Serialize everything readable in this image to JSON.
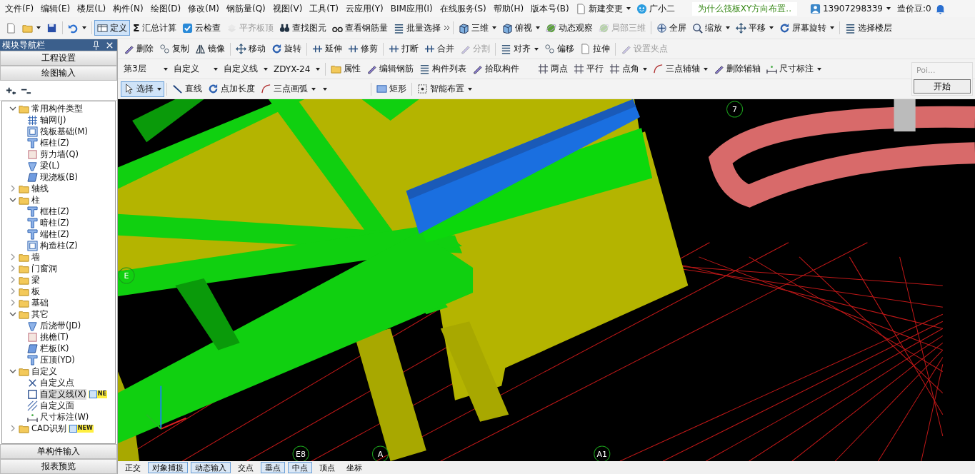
{
  "menu": [
    "文件(F)",
    "编辑(E)",
    "楼层(L)",
    "构件(N)",
    "绘图(D)",
    "修改(M)",
    "钢筋量(Q)",
    "视图(V)",
    "工具(T)",
    "云应用(Y)",
    "BIM应用(I)",
    "在线服务(S)",
    "帮助(H)",
    "版本号(B)"
  ],
  "top_right": {
    "new_change": "新建变更",
    "assistant": "广小二",
    "question": "为什么筏板XY方向布置..",
    "account": "13907298339",
    "beans": "造价豆:0"
  },
  "main_toolbar": [
    [
      {
        "dropdown": false,
        "disabled": false,
        "selected": false
      },
      {
        "dropdown": true,
        "disabled": false,
        "selected": false
      },
      {
        "dropdown": false,
        "disabled": false,
        "selected": false
      }
    ],
    [
      {
        "dropdown": true,
        "disabled": false,
        "selected": false
      }
    ],
    [
      {
        "label": "定义",
        "dropdown": false,
        "disabled": false,
        "selected": true
      },
      {
        "label": "汇总计算",
        "glyph": "Σ",
        "dropdown": false,
        "disabled": false,
        "selected": false
      },
      {
        "label": "云检查",
        "dropdown": false,
        "disabled": false,
        "selected": false
      },
      {
        "label": "平齐板顶",
        "dropdown": false,
        "disabled": true,
        "selected": false
      },
      {
        "label": "查找图元",
        "dropdown": false,
        "disabled": false,
        "selected": false
      },
      {
        "label": "查看钢筋量",
        "dropdown": false,
        "disabled": false,
        "selected": false
      },
      {
        "label": "批量选择",
        "dropdown": false,
        "disabled": false,
        "selected": false
      }
    ]
  ],
  "view_toolbar": [
    [
      {
        "label": "三维",
        "dropdown": true,
        "disabled": false,
        "selected": false
      },
      {
        "label": "俯视",
        "dropdown": true,
        "disabled": false,
        "selected": false
      },
      {
        "label": "动态观察",
        "dropdown": false,
        "disabled": false,
        "selected": false
      },
      {
        "label": "局部三维",
        "dropdown": false,
        "disabled": true,
        "selected": false
      }
    ],
    [
      {
        "label": "全屏",
        "dropdown": false,
        "disabled": false,
        "selected": false
      },
      {
        "label": "缩放",
        "dropdown": true,
        "disabled": false,
        "selected": false
      },
      {
        "label": "平移",
        "dropdown": true,
        "disabled": false,
        "selected": false
      },
      {
        "label": "屏幕旋转",
        "dropdown": true,
        "disabled": false,
        "selected": false
      }
    ],
    [
      {
        "label": "选择楼层",
        "dropdown": false,
        "disabled": false,
        "selected": false
      }
    ]
  ],
  "edit_toolbar": [
    [
      {
        "label": "删除",
        "dropdown": false,
        "disabled": false,
        "selected": false
      },
      {
        "label": "复制",
        "dropdown": false,
        "disabled": false,
        "selected": false
      },
      {
        "label": "镜像",
        "dropdown": false,
        "disabled": false,
        "selected": false
      }
    ],
    [
      {
        "label": "移动",
        "dropdown": false,
        "disabled": false,
        "selected": false
      },
      {
        "label": "旋转",
        "dropdown": false,
        "disabled": false,
        "selected": false
      }
    ],
    [
      {
        "label": "延伸",
        "dropdown": false,
        "disabled": false,
        "selected": false
      },
      {
        "label": "修剪",
        "dropdown": false,
        "disabled": false,
        "selected": false
      }
    ],
    [
      {
        "label": "打断",
        "dropdown": false,
        "disabled": false,
        "selected": false
      },
      {
        "label": "合并",
        "dropdown": false,
        "disabled": false,
        "selected": false
      },
      {
        "label": "分割",
        "dropdown": false,
        "disabled": true,
        "selected": false
      }
    ],
    [
      {
        "label": "对齐",
        "dropdown": true,
        "disabled": false,
        "selected": false
      },
      {
        "label": "偏移",
        "dropdown": false,
        "disabled": false,
        "selected": false
      },
      {
        "label": "拉伸",
        "dropdown": false,
        "disabled": false,
        "selected": false
      }
    ],
    [
      {
        "label": "设置夹点",
        "dropdown": false,
        "disabled": true,
        "selected": false
      }
    ]
  ],
  "layer_toolbar": [
    [
      {
        "kind": "combo",
        "value": "第3层"
      },
      {
        "kind": "combo",
        "value": "自定义"
      },
      {
        "kind": "combo",
        "value": "自定义线"
      },
      {
        "kind": "combo",
        "value": "ZDYX-24"
      }
    ],
    [
      {
        "kind": "button",
        "label": "属性",
        "dropdown": false,
        "disabled": false,
        "selected": false
      },
      {
        "kind": "button",
        "label": "编辑钢筋",
        "dropdown": false,
        "disabled": false,
        "selected": false
      },
      {
        "kind": "button",
        "label": "构件列表",
        "dropdown": false,
        "disabled": false,
        "selected": false
      },
      {
        "kind": "button",
        "label": "拾取构件",
        "dropdown": false,
        "disabled": false,
        "selected": false
      }
    ]
  ],
  "axis_toolbar": [
    [
      {
        "label": "两点",
        "dropdown": false,
        "disabled": false,
        "selected": false
      },
      {
        "label": "平行",
        "dropdown": false,
        "disabled": false,
        "selected": false
      },
      {
        "label": "点角",
        "dropdown": true,
        "disabled": false,
        "selected": false
      },
      {
        "label": "三点辅轴",
        "dropdown": true,
        "disabled": false,
        "selected": false
      },
      {
        "label": "删除辅轴",
        "dropdown": false,
        "disabled": false,
        "selected": false
      },
      {
        "label": "尺寸标注",
        "dropdown": true,
        "disabled": false,
        "selected": false
      }
    ]
  ],
  "draw_toolbar": [
    [
      {
        "kind": "button",
        "label": "选择",
        "dropdown": true,
        "disabled": false,
        "selected": true
      }
    ],
    [
      {
        "kind": "button",
        "label": "直线",
        "dropdown": false,
        "disabled": false,
        "selected": false
      },
      {
        "kind": "button",
        "label": "点加长度",
        "dropdown": false,
        "disabled": false,
        "selected": false
      },
      {
        "kind": "button",
        "label": "三点画弧",
        "dropdown": true,
        "disabled": false,
        "selected": false
      },
      {
        "kind": "combo"
      }
    ],
    [
      {
        "kind": "button",
        "label": "矩形",
        "dropdown": false,
        "disabled": false,
        "selected": false
      }
    ],
    [
      {
        "kind": "button",
        "label": "智能布置",
        "dropdown": true,
        "disabled": false,
        "selected": false
      }
    ]
  ],
  "navigator": {
    "title": "模块导航栏",
    "buttons": [
      "工程设置",
      "绘图输入"
    ],
    "tree": [
      {
        "label": "常用构件类型",
        "expanded": true,
        "selected": false,
        "children": [
          {
            "label": "轴网(J)",
            "kind": "grid",
            "selected": false
          },
          {
            "label": "筏板基础(M)",
            "kind": "foundation",
            "selected": false
          },
          {
            "label": "框柱(Z)",
            "kind": "column",
            "selected": false
          },
          {
            "label": "剪力墙(Q)",
            "kind": "wall",
            "selected": false
          },
          {
            "label": "梁(L)",
            "kind": "beam",
            "selected": false
          },
          {
            "label": "现浇板(B)",
            "kind": "slab",
            "selected": false
          }
        ]
      },
      {
        "label": "轴线",
        "expanded": false,
        "selected": false
      },
      {
        "label": "柱",
        "expanded": true,
        "selected": false,
        "children": [
          {
            "label": "框柱(Z)",
            "kind": "column",
            "selected": false
          },
          {
            "label": "暗柱(Z)",
            "kind": "column",
            "selected": false
          },
          {
            "label": "端柱(Z)",
            "kind": "column",
            "selected": false
          },
          {
            "label": "构造柱(Z)",
            "kind": "foundation",
            "selected": false
          }
        ]
      },
      {
        "label": "墙",
        "expanded": false,
        "selected": false
      },
      {
        "label": "门窗洞",
        "expanded": false,
        "selected": false
      },
      {
        "label": "梁",
        "expanded": false,
        "selected": false
      },
      {
        "label": "板",
        "expanded": false,
        "selected": false
      },
      {
        "label": "基础",
        "expanded": false,
        "selected": false
      },
      {
        "label": "其它",
        "expanded": true,
        "selected": false,
        "children": [
          {
            "label": "后浇带(JD)",
            "kind": "beam",
            "selected": false
          },
          {
            "label": "挑檐(T)",
            "kind": "wall",
            "selected": false
          },
          {
            "label": "栏板(K)",
            "kind": "slab",
            "selected": false
          },
          {
            "label": "压顶(YD)",
            "kind": "column",
            "selected": false
          }
        ]
      },
      {
        "label": "自定义",
        "expanded": true,
        "selected": false,
        "children": [
          {
            "label": "自定义点",
            "kind": "point",
            "selected": false
          },
          {
            "label": "自定义线(X)",
            "kind": "line",
            "selected": true,
            "badge": "NE"
          },
          {
            "label": "自定义面",
            "kind": "area",
            "selected": false
          },
          {
            "label": "尺寸标注(W)",
            "kind": "dimension",
            "selected": false
          }
        ]
      },
      {
        "label": "CAD识别",
        "expanded": false,
        "selected": false,
        "badge": "NEW"
      }
    ],
    "bottom_buttons": [
      "单构件输入",
      "报表预览"
    ]
  },
  "popup": {
    "title": "Poi...",
    "button": "开始"
  },
  "viewport": {
    "axis_labels": [
      "7",
      "E",
      "E8",
      "A",
      "A1"
    ]
  },
  "status_bar": [
    {
      "label": "正交",
      "selected": false
    },
    {
      "label": "对象捕捉",
      "selected": true
    },
    {
      "label": "动态输入",
      "selected": true
    },
    {
      "label": "交点",
      "selected": false
    },
    {
      "label": "垂点",
      "selected": true
    },
    {
      "label": "中点",
      "selected": true
    },
    {
      "label": "顶点",
      "selected": false
    },
    {
      "label": "坐标",
      "selected": false
    }
  ]
}
